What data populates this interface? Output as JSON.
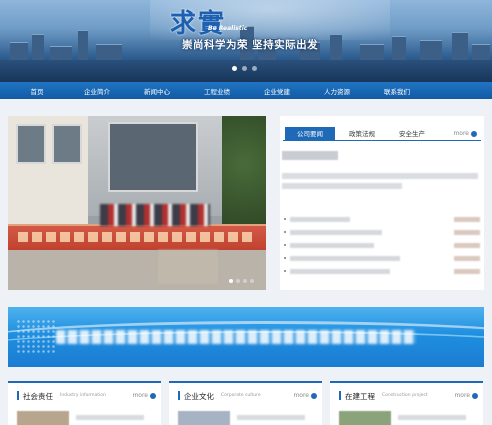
{
  "header": {
    "logo_text": "求實",
    "logo_sub": "Be Realistic",
    "slogan": "崇尚科学为荣 坚持实际出发"
  },
  "nav": {
    "items": [
      "首页",
      "企业简介",
      "新闻中心",
      "工程业绩",
      "企业党建",
      "人力资源",
      "联系我们"
    ]
  },
  "news": {
    "tabs": [
      "公司要闻",
      "政策法规",
      "安全生产"
    ],
    "active_tab": "公司要闻",
    "more": "more"
  },
  "sections": [
    {
      "title": "社会责任",
      "subtitle": "Industry information",
      "more": "more"
    },
    {
      "title": "企业文化",
      "subtitle": "Corporate culture",
      "more": "more"
    },
    {
      "title": "在建工程",
      "subtitle": "Construction project",
      "more": "more"
    }
  ],
  "colors": {
    "brand_blue": "#1f6ab7",
    "nav_blue": "#1a67b5",
    "promo_blue": "#1f8fe0"
  }
}
